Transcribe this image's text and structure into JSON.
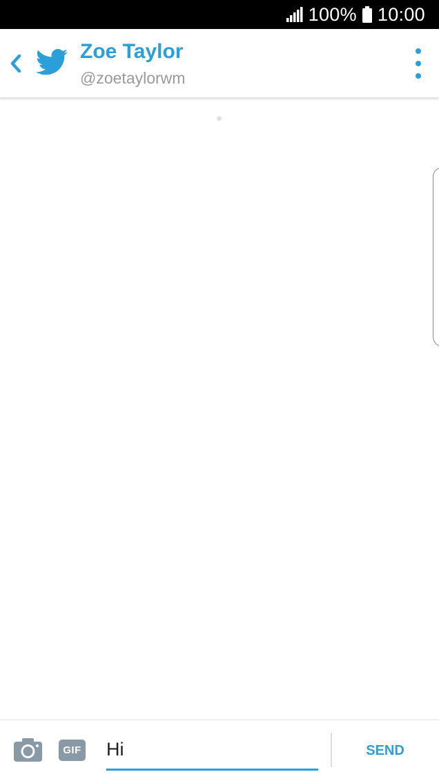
{
  "status_bar": {
    "battery_percent": "100%",
    "time": "10:00",
    "icons": [
      "signal-icon",
      "battery-icon"
    ]
  },
  "header": {
    "title": "Zoe Taylor",
    "subtitle": "@zoetaylorwm",
    "icons": [
      "back-arrow-icon",
      "twitter-bird-icon",
      "more-options-icon"
    ]
  },
  "composer": {
    "input_value": "Hi",
    "gif_label": "GIF",
    "send_label": "SEND",
    "icons": [
      "camera-icon"
    ]
  },
  "colors": {
    "accent": "#2a9fd8",
    "gif_badge": "#8a99a6",
    "subtitle": "#9a9a9a",
    "status_bar": "#000000"
  }
}
